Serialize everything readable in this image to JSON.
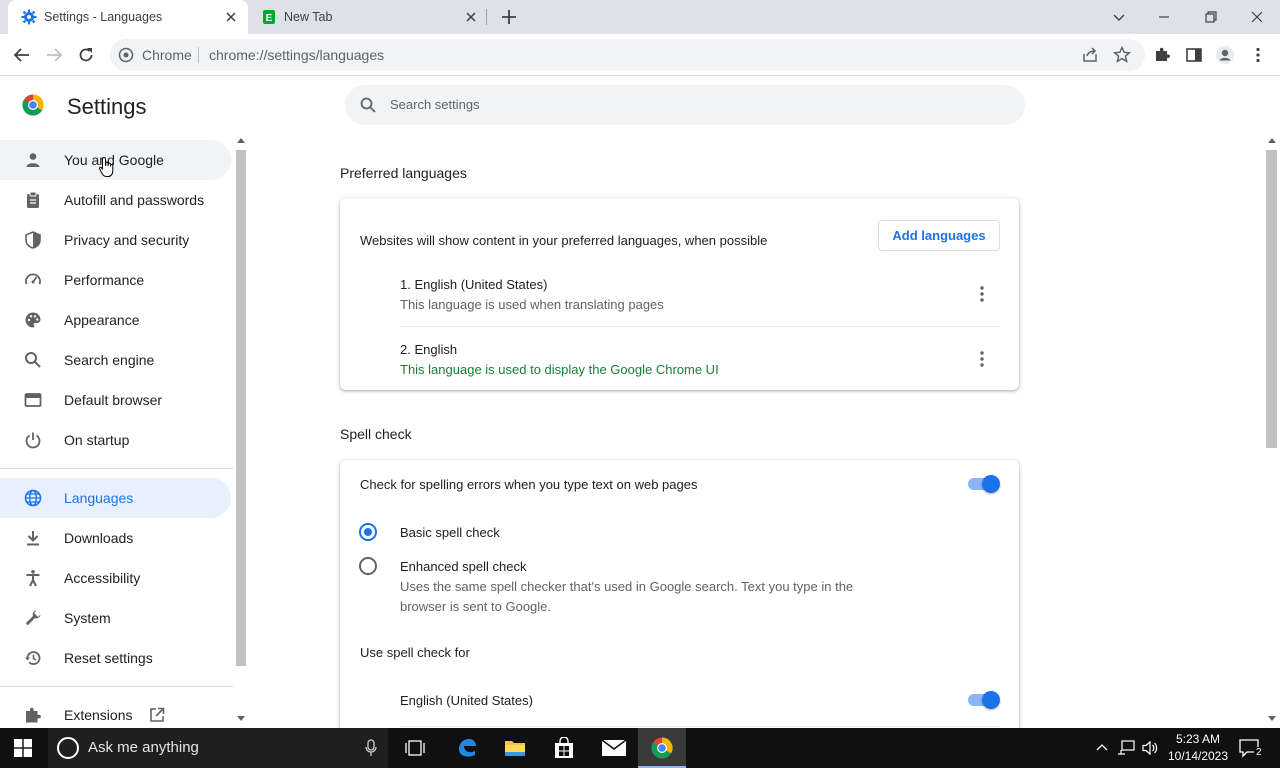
{
  "browser": {
    "tabs": [
      {
        "title": "Settings - Languages",
        "favicon": "gear-icon",
        "active": true
      },
      {
        "title": "New Tab",
        "favicon": "evernote-icon",
        "active": false
      }
    ],
    "omnibox": {
      "chip": "Chrome",
      "url": "chrome://settings/languages"
    }
  },
  "settings": {
    "title": "Settings",
    "search_placeholder": "Search settings",
    "nav": [
      {
        "label": "You and Google",
        "icon": "person-icon"
      },
      {
        "label": "Autofill and passwords",
        "icon": "clipboard-icon"
      },
      {
        "label": "Privacy and security",
        "icon": "shield-icon"
      },
      {
        "label": "Performance",
        "icon": "speedometer-icon"
      },
      {
        "label": "Appearance",
        "icon": "palette-icon"
      },
      {
        "label": "Search engine",
        "icon": "search-icon"
      },
      {
        "label": "Default browser",
        "icon": "browser-window-icon"
      },
      {
        "label": "On startup",
        "icon": "power-icon"
      },
      {
        "label": "Languages",
        "icon": "globe-icon"
      },
      {
        "label": "Downloads",
        "icon": "download-icon"
      },
      {
        "label": "Accessibility",
        "icon": "accessibility-icon"
      },
      {
        "label": "System",
        "icon": "wrench-icon"
      },
      {
        "label": "Reset settings",
        "icon": "history-icon"
      },
      {
        "label": "Extensions",
        "icon": "puzzle-icon"
      }
    ],
    "preferred_languages": {
      "title": "Preferred languages",
      "description": "Websites will show content in your preferred languages, when possible",
      "add_button": "Add languages",
      "languages": [
        {
          "name": "1. English (United States)",
          "note": "This language is used when translating pages"
        },
        {
          "name": "2. English",
          "note": "This language is used to display the Google Chrome UI"
        }
      ]
    },
    "spell_check": {
      "title": "Spell check",
      "toggle_label": "Check for spelling errors when you type text on web pages",
      "toggle_on": true,
      "basic_label": "Basic spell check",
      "enhanced_label": "Enhanced spell check",
      "enhanced_desc_line1": "Uses the same spell checker that's used in Google search. Text you type in the",
      "enhanced_desc_line2": "browser is sent to Google.",
      "selected": "basic",
      "use_for_label": "Use spell check for",
      "use_for": [
        {
          "language": "English (United States)",
          "enabled": true
        }
      ]
    }
  },
  "taskbar": {
    "search_placeholder": "Ask me anything",
    "time": "5:23 AM",
    "date": "10/14/2023",
    "notification_count": "2"
  },
  "colors": {
    "accent": "#1a73e8",
    "green_note": "#188038",
    "selected_nav_bg": "#e8f0fe"
  }
}
